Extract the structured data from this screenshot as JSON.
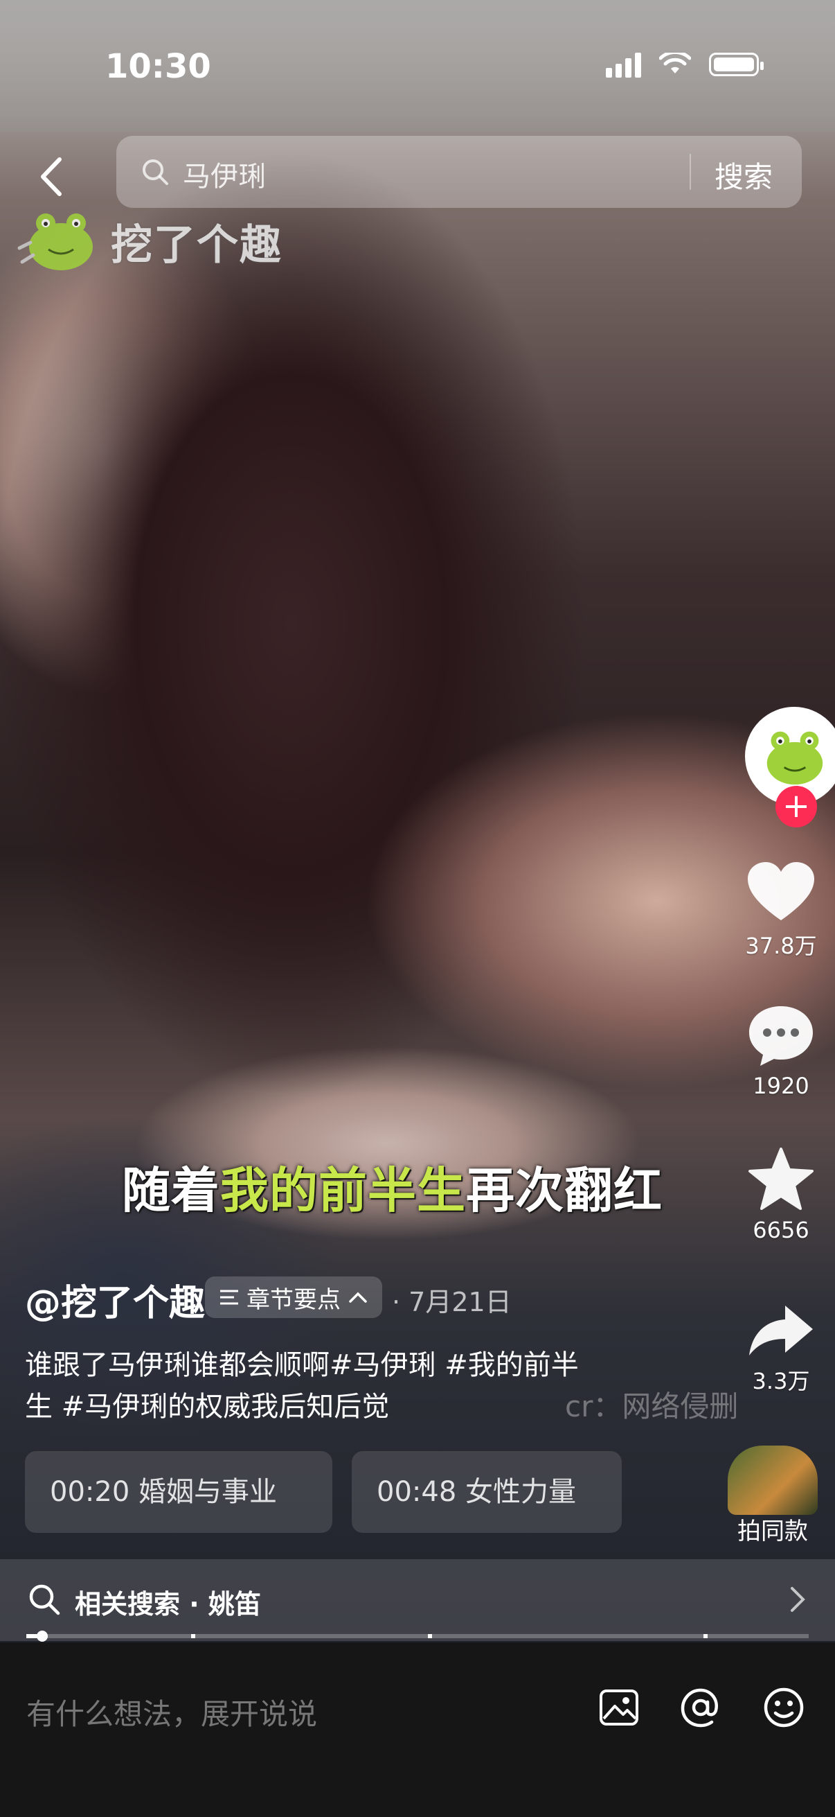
{
  "status_bar": {
    "time": "10:30"
  },
  "search": {
    "query": "马伊琍",
    "button_label": "搜索"
  },
  "watermark": {
    "text": "挖了个趣"
  },
  "actions": {
    "likes": "37.8万",
    "comments": "1920",
    "favorites": "6656",
    "shares": "3.3万",
    "same_style": "拍同款"
  },
  "subtitle": {
    "before": "随着",
    "highlight": "我的前半生",
    "after": "再次翻红"
  },
  "post": {
    "author": "@挖了个趣",
    "chapter_label": "章节要点",
    "date": "· 7月21日",
    "caption_line1": "谁跟了马伊琍谁都会顺啊#马伊琍  #我的前半",
    "caption_line2": "生 #马伊琍的权威我后知后觉",
    "credit": "cr：网络侵删"
  },
  "chapters": [
    {
      "label": "00:20 婚姻与事业"
    },
    {
      "label": "00:48 女性力量"
    }
  ],
  "related": {
    "label": "相关搜索 · 姚笛"
  },
  "video_progress": 0.02,
  "comment": {
    "placeholder": "有什么想法，展开说说"
  },
  "colors": {
    "highlight": "#c7e74a",
    "follow": "#fd2c55",
    "bar_bg": "#161616"
  },
  "icons": [
    "back-icon",
    "search-icon",
    "heart-icon",
    "comment-icon",
    "star-icon",
    "share-icon",
    "chevron-right-icon",
    "image-icon",
    "at-icon",
    "emoji-icon"
  ]
}
